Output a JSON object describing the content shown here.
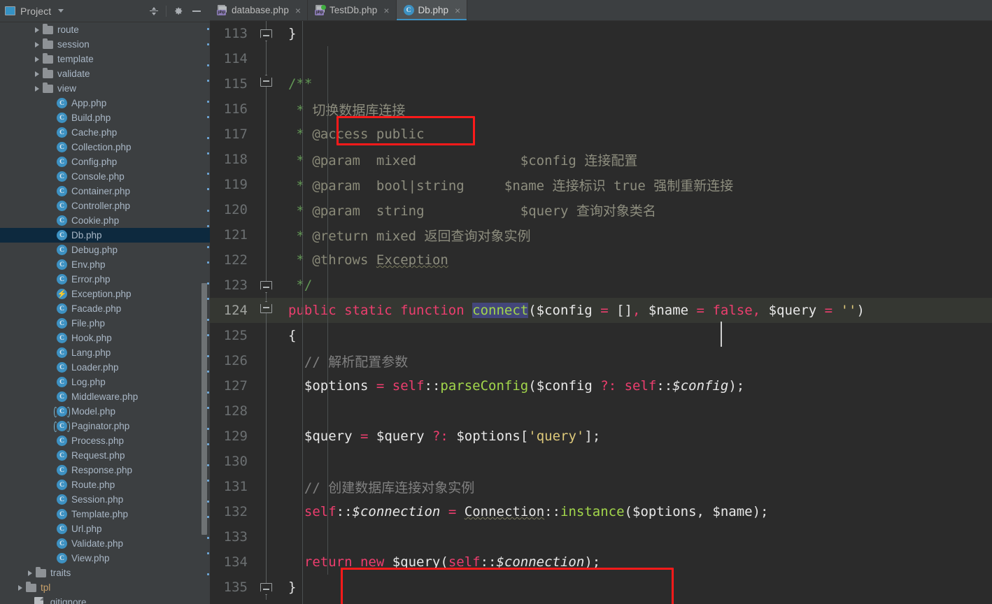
{
  "sidebar": {
    "title": "Project",
    "toolbar_buttons": [
      {
        "name": "collapse-all-button",
        "label": "Collapse All"
      },
      {
        "name": "settings-button",
        "label": "Settings"
      },
      {
        "name": "hide-button",
        "label": "Hide"
      }
    ],
    "items": [
      {
        "label": "route",
        "type": "folder",
        "indent": 2,
        "expandable": true,
        "selected": false
      },
      {
        "label": "session",
        "type": "folder",
        "indent": 2,
        "expandable": true,
        "selected": false
      },
      {
        "label": "template",
        "type": "folder",
        "indent": 2,
        "expandable": true,
        "selected": false
      },
      {
        "label": "validate",
        "type": "folder",
        "indent": 2,
        "expandable": true,
        "selected": false
      },
      {
        "label": "view",
        "type": "folder",
        "indent": 2,
        "expandable": true,
        "selected": false
      },
      {
        "label": "App.php",
        "type": "class",
        "indent": 3,
        "expandable": false,
        "selected": false
      },
      {
        "label": "Build.php",
        "type": "class",
        "indent": 3,
        "expandable": false,
        "selected": false
      },
      {
        "label": "Cache.php",
        "type": "class",
        "indent": 3,
        "expandable": false,
        "selected": false
      },
      {
        "label": "Collection.php",
        "type": "class",
        "indent": 3,
        "expandable": false,
        "selected": false
      },
      {
        "label": "Config.php",
        "type": "class",
        "indent": 3,
        "expandable": false,
        "selected": false
      },
      {
        "label": "Console.php",
        "type": "class",
        "indent": 3,
        "expandable": false,
        "selected": false
      },
      {
        "label": "Container.php",
        "type": "class",
        "indent": 3,
        "expandable": false,
        "selected": false
      },
      {
        "label": "Controller.php",
        "type": "class",
        "indent": 3,
        "expandable": false,
        "selected": false
      },
      {
        "label": "Cookie.php",
        "type": "class",
        "indent": 3,
        "expandable": false,
        "selected": false
      },
      {
        "label": "Db.php",
        "type": "class",
        "indent": 3,
        "expandable": false,
        "selected": true
      },
      {
        "label": "Debug.php",
        "type": "class",
        "indent": 3,
        "expandable": false,
        "selected": false
      },
      {
        "label": "Env.php",
        "type": "class",
        "indent": 3,
        "expandable": false,
        "selected": false
      },
      {
        "label": "Error.php",
        "type": "class",
        "indent": 3,
        "expandable": false,
        "selected": false
      },
      {
        "label": "Exception.php",
        "type": "exception",
        "indent": 3,
        "expandable": false,
        "selected": false
      },
      {
        "label": "Facade.php",
        "type": "class",
        "indent": 3,
        "expandable": false,
        "selected": false
      },
      {
        "label": "File.php",
        "type": "class",
        "indent": 3,
        "expandable": false,
        "selected": false
      },
      {
        "label": "Hook.php",
        "type": "class",
        "indent": 3,
        "expandable": false,
        "selected": false
      },
      {
        "label": "Lang.php",
        "type": "class",
        "indent": 3,
        "expandable": false,
        "selected": false
      },
      {
        "label": "Loader.php",
        "type": "class",
        "indent": 3,
        "expandable": false,
        "selected": false
      },
      {
        "label": "Log.php",
        "type": "class",
        "indent": 3,
        "expandable": false,
        "selected": false
      },
      {
        "label": "Middleware.php",
        "type": "class",
        "indent": 3,
        "expandable": false,
        "selected": false
      },
      {
        "label": "Model.php",
        "type": "abstract",
        "indent": 3,
        "expandable": false,
        "selected": false
      },
      {
        "label": "Paginator.php",
        "type": "abstract",
        "indent": 3,
        "expandable": false,
        "selected": false
      },
      {
        "label": "Process.php",
        "type": "class",
        "indent": 3,
        "expandable": false,
        "selected": false
      },
      {
        "label": "Request.php",
        "type": "class",
        "indent": 3,
        "expandable": false,
        "selected": false
      },
      {
        "label": "Response.php",
        "type": "class",
        "indent": 3,
        "expandable": false,
        "selected": false
      },
      {
        "label": "Route.php",
        "type": "class",
        "indent": 3,
        "expandable": false,
        "selected": false
      },
      {
        "label": "Session.php",
        "type": "class",
        "indent": 3,
        "expandable": false,
        "selected": false
      },
      {
        "label": "Template.php",
        "type": "class",
        "indent": 3,
        "expandable": false,
        "selected": false
      },
      {
        "label": "Url.php",
        "type": "class",
        "indent": 3,
        "expandable": false,
        "selected": false
      },
      {
        "label": "Validate.php",
        "type": "class",
        "indent": 3,
        "expandable": false,
        "selected": false
      },
      {
        "label": "View.php",
        "type": "class",
        "indent": 3,
        "expandable": false,
        "selected": false
      },
      {
        "label": "traits",
        "type": "folder",
        "indent": 1.5,
        "expandable": true,
        "selected": false
      },
      {
        "label": "tpl",
        "type": "folder",
        "indent": 0.8,
        "expandable": true,
        "selected": false,
        "accent": true
      },
      {
        "label": ".gitignore",
        "type": "gitignore",
        "indent": 1.4,
        "expandable": false,
        "selected": false
      }
    ]
  },
  "tabs": [
    {
      "label": "database.php",
      "icon": "php-file-icon",
      "active": false,
      "modified": false
    },
    {
      "label": "TestDb.php",
      "icon": "php-file-icon",
      "active": false,
      "modified": true
    },
    {
      "label": "Db.php",
      "icon": "class-icon",
      "active": true,
      "modified": false
    }
  ],
  "editor": {
    "lines": [
      {
        "num": "113",
        "fold": "end",
        "current": false
      },
      {
        "num": "114",
        "fold": "none",
        "current": false
      },
      {
        "num": "115",
        "fold": "start",
        "current": false
      },
      {
        "num": "116",
        "fold": "none",
        "current": false
      },
      {
        "num": "117",
        "fold": "none",
        "current": false
      },
      {
        "num": "118",
        "fold": "none",
        "current": false
      },
      {
        "num": "119",
        "fold": "none",
        "current": false
      },
      {
        "num": "120",
        "fold": "none",
        "current": false
      },
      {
        "num": "121",
        "fold": "none",
        "current": false
      },
      {
        "num": "122",
        "fold": "none",
        "current": false
      },
      {
        "num": "123",
        "fold": "end",
        "current": false
      },
      {
        "num": "124",
        "fold": "start",
        "current": true
      },
      {
        "num": "125",
        "fold": "none",
        "current": false
      },
      {
        "num": "126",
        "fold": "none",
        "current": false
      },
      {
        "num": "127",
        "fold": "none",
        "current": false
      },
      {
        "num": "128",
        "fold": "none",
        "current": false
      },
      {
        "num": "129",
        "fold": "none",
        "current": false
      },
      {
        "num": "130",
        "fold": "none",
        "current": false
      },
      {
        "num": "131",
        "fold": "none",
        "current": false
      },
      {
        "num": "132",
        "fold": "none",
        "current": false
      },
      {
        "num": "133",
        "fold": "none",
        "current": false
      },
      {
        "num": "134",
        "fold": "none",
        "current": false
      },
      {
        "num": "135",
        "fold": "end",
        "current": false
      }
    ],
    "code": {
      "l113": "}",
      "l114": "",
      "l115_open": "/**",
      "l116_star": "*",
      "l116_text": "切换数据库连接",
      "l117_star": "*",
      "l117_tag": "@access",
      "l117_val": "public",
      "l118_star": "*",
      "l118_tag": "@param",
      "l118_type": "mixed",
      "l118_var": "$config",
      "l118_desc": "连接配置",
      "l119_star": "*",
      "l119_tag": "@param",
      "l119_type": "bool|string",
      "l119_var": "$name",
      "l119_desc": "连接标识 true 强制重新连接",
      "l120_star": "*",
      "l120_tag": "@param",
      "l120_type": "string",
      "l120_var": "$query",
      "l120_desc": "查询对象类名",
      "l121_star": "*",
      "l121_tag": "@return",
      "l121_type": "mixed",
      "l121_desc": "返回查询对象实例",
      "l122_star": "*",
      "l122_tag": "@throws",
      "l122_type": "Exception",
      "l123_close": "*/",
      "l124_kw": "public static function",
      "l124_fn": "connect",
      "l124_sig": "($config = [], $name = false, $query = '')",
      "l125": "{",
      "l126_comment": "// 解析配置参数",
      "l127": "$options = self::parseConfig($config ?: self::$config);",
      "l128": "",
      "l129": "$query = $query ?: $options['query'];",
      "l130": "",
      "l131_comment": "// 创建数据库连接对象实例",
      "l132": "self::$connection = Connection::instance($options, $name);",
      "l133": "",
      "l134": "return new $query(self::$connection);",
      "l135": "}"
    },
    "annotations": [
      {
        "name": "annotation-box-summary",
        "color": "#fb1a1a"
      },
      {
        "name": "annotation-box-return",
        "color": "#fb1a1a"
      }
    ]
  }
}
